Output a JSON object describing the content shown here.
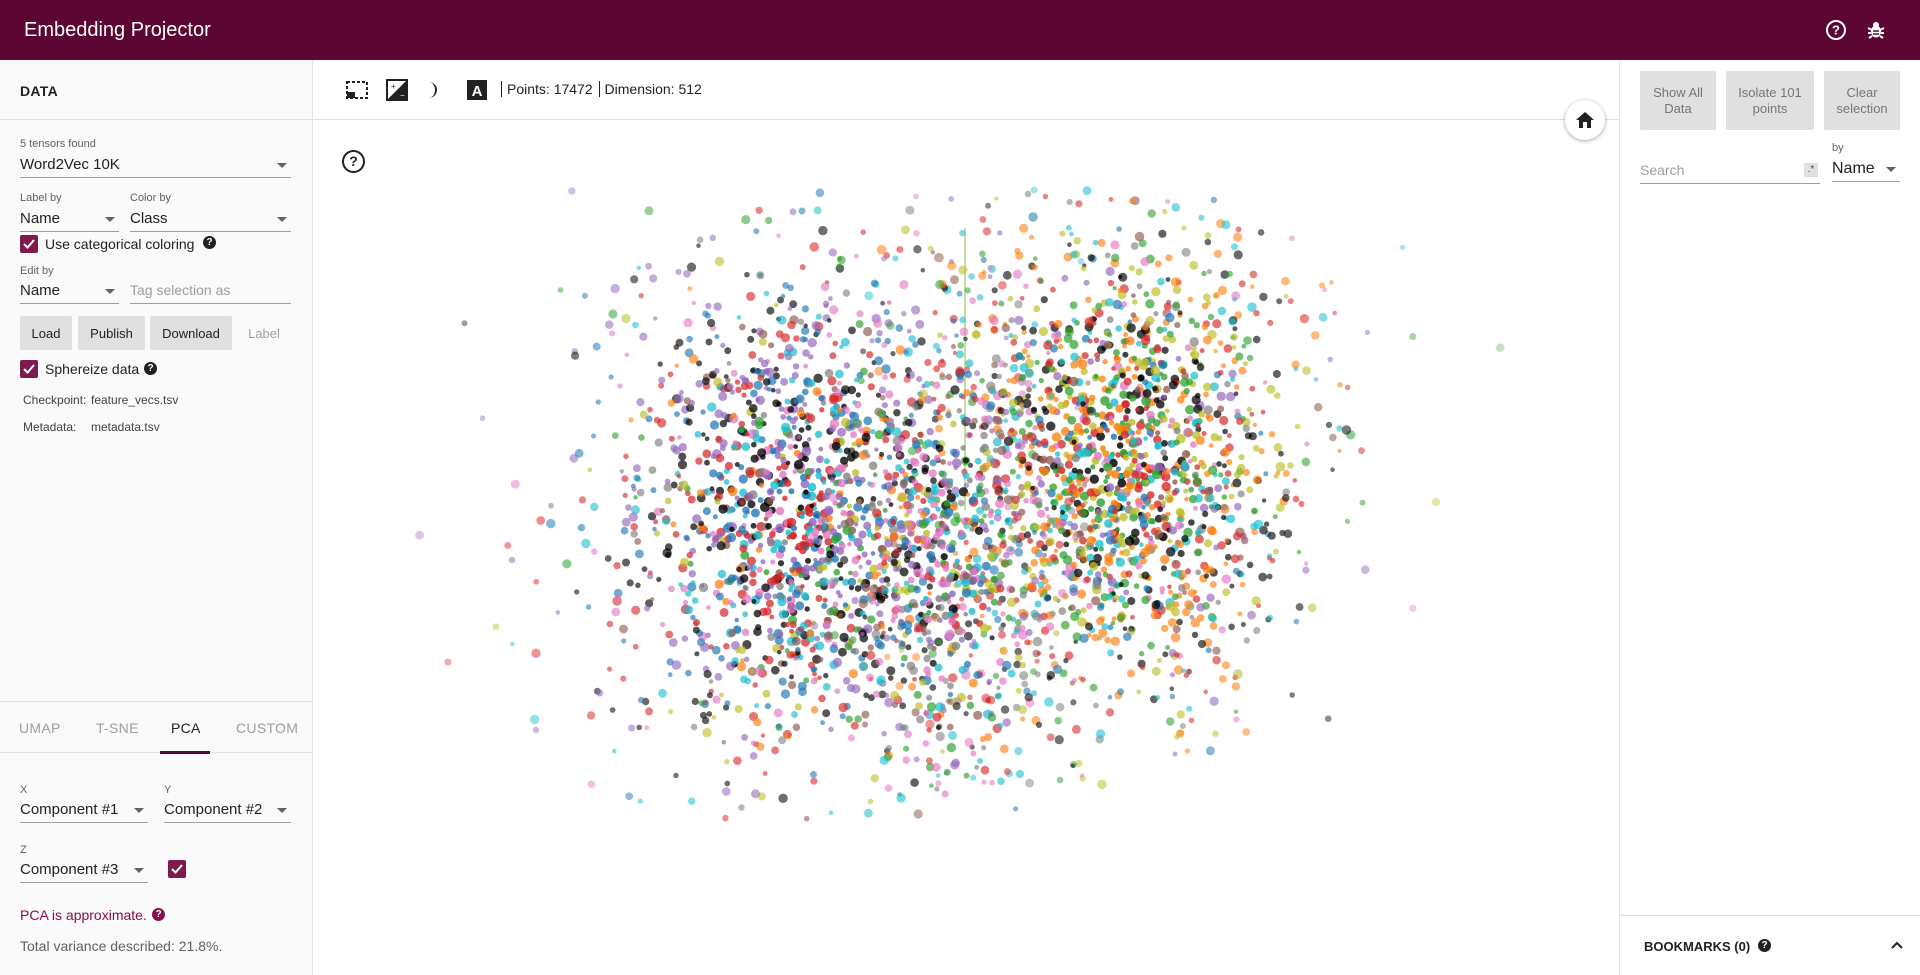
{
  "app": {
    "title": "Embedding Projector",
    "header_icons": [
      "help-circle-icon",
      "bug-icon"
    ]
  },
  "data_panel": {
    "header": "DATA",
    "tensors_found": "5 tensors found",
    "tensor": "Word2Vec 10K",
    "label_by": {
      "label": "Label by",
      "value": "Name"
    },
    "color_by": {
      "label": "Color by",
      "value": "Class"
    },
    "categorical_coloring": {
      "label": "Use categorical coloring",
      "checked": true
    },
    "edit_by": {
      "label": "Edit by",
      "value": "Name"
    },
    "tag_selection_placeholder": "Tag selection as",
    "buttons": {
      "load": "Load",
      "publish": "Publish",
      "download": "Download",
      "label": "Label"
    },
    "sphereize": {
      "label": "Sphereize data",
      "checked": true
    },
    "checkpoint": {
      "key": "Checkpoint:",
      "value": "feature_vecs.tsv"
    },
    "metadata": {
      "key": "Metadata:",
      "value": "metadata.tsv"
    }
  },
  "projection_tabs": {
    "items": [
      "UMAP",
      "T-SNE",
      "PCA",
      "CUSTOM"
    ],
    "active": "PCA"
  },
  "pca": {
    "x": {
      "label": "X",
      "value": "Component #1"
    },
    "y": {
      "label": "Y",
      "value": "Component #2"
    },
    "z": {
      "label": "Z",
      "value": "Component #3"
    },
    "z_enabled": true,
    "approx_note": "PCA is approximate.",
    "variance": "Total variance described: 21.8%."
  },
  "toolbar": {
    "tools": [
      "select-rect-icon",
      "night-mode-icon",
      "dark-mode-icon",
      "label-toggle-icon"
    ],
    "points_label": "Points:",
    "points_value": "17472",
    "dimension_label": "Dimension:",
    "dimension_value": "512"
  },
  "scatter": {
    "palette": [
      "#1f77b4",
      "#ff7f0e",
      "#2ca02c",
      "#d62728",
      "#9467bd",
      "#8c564b",
      "#e377c2",
      "#7f7f7f",
      "#bcbd22",
      "#17becf",
      "#000000"
    ],
    "axis_color": "#9ccc65"
  },
  "inspector": {
    "show_all": "Show All Data",
    "isolate": "Isolate 101 points",
    "clear": "Clear selection",
    "search_placeholder": "Search",
    "regex_icon": ".*",
    "by_label": "by",
    "by_value": "Name",
    "bookmarks": "BOOKMARKS (0)"
  }
}
